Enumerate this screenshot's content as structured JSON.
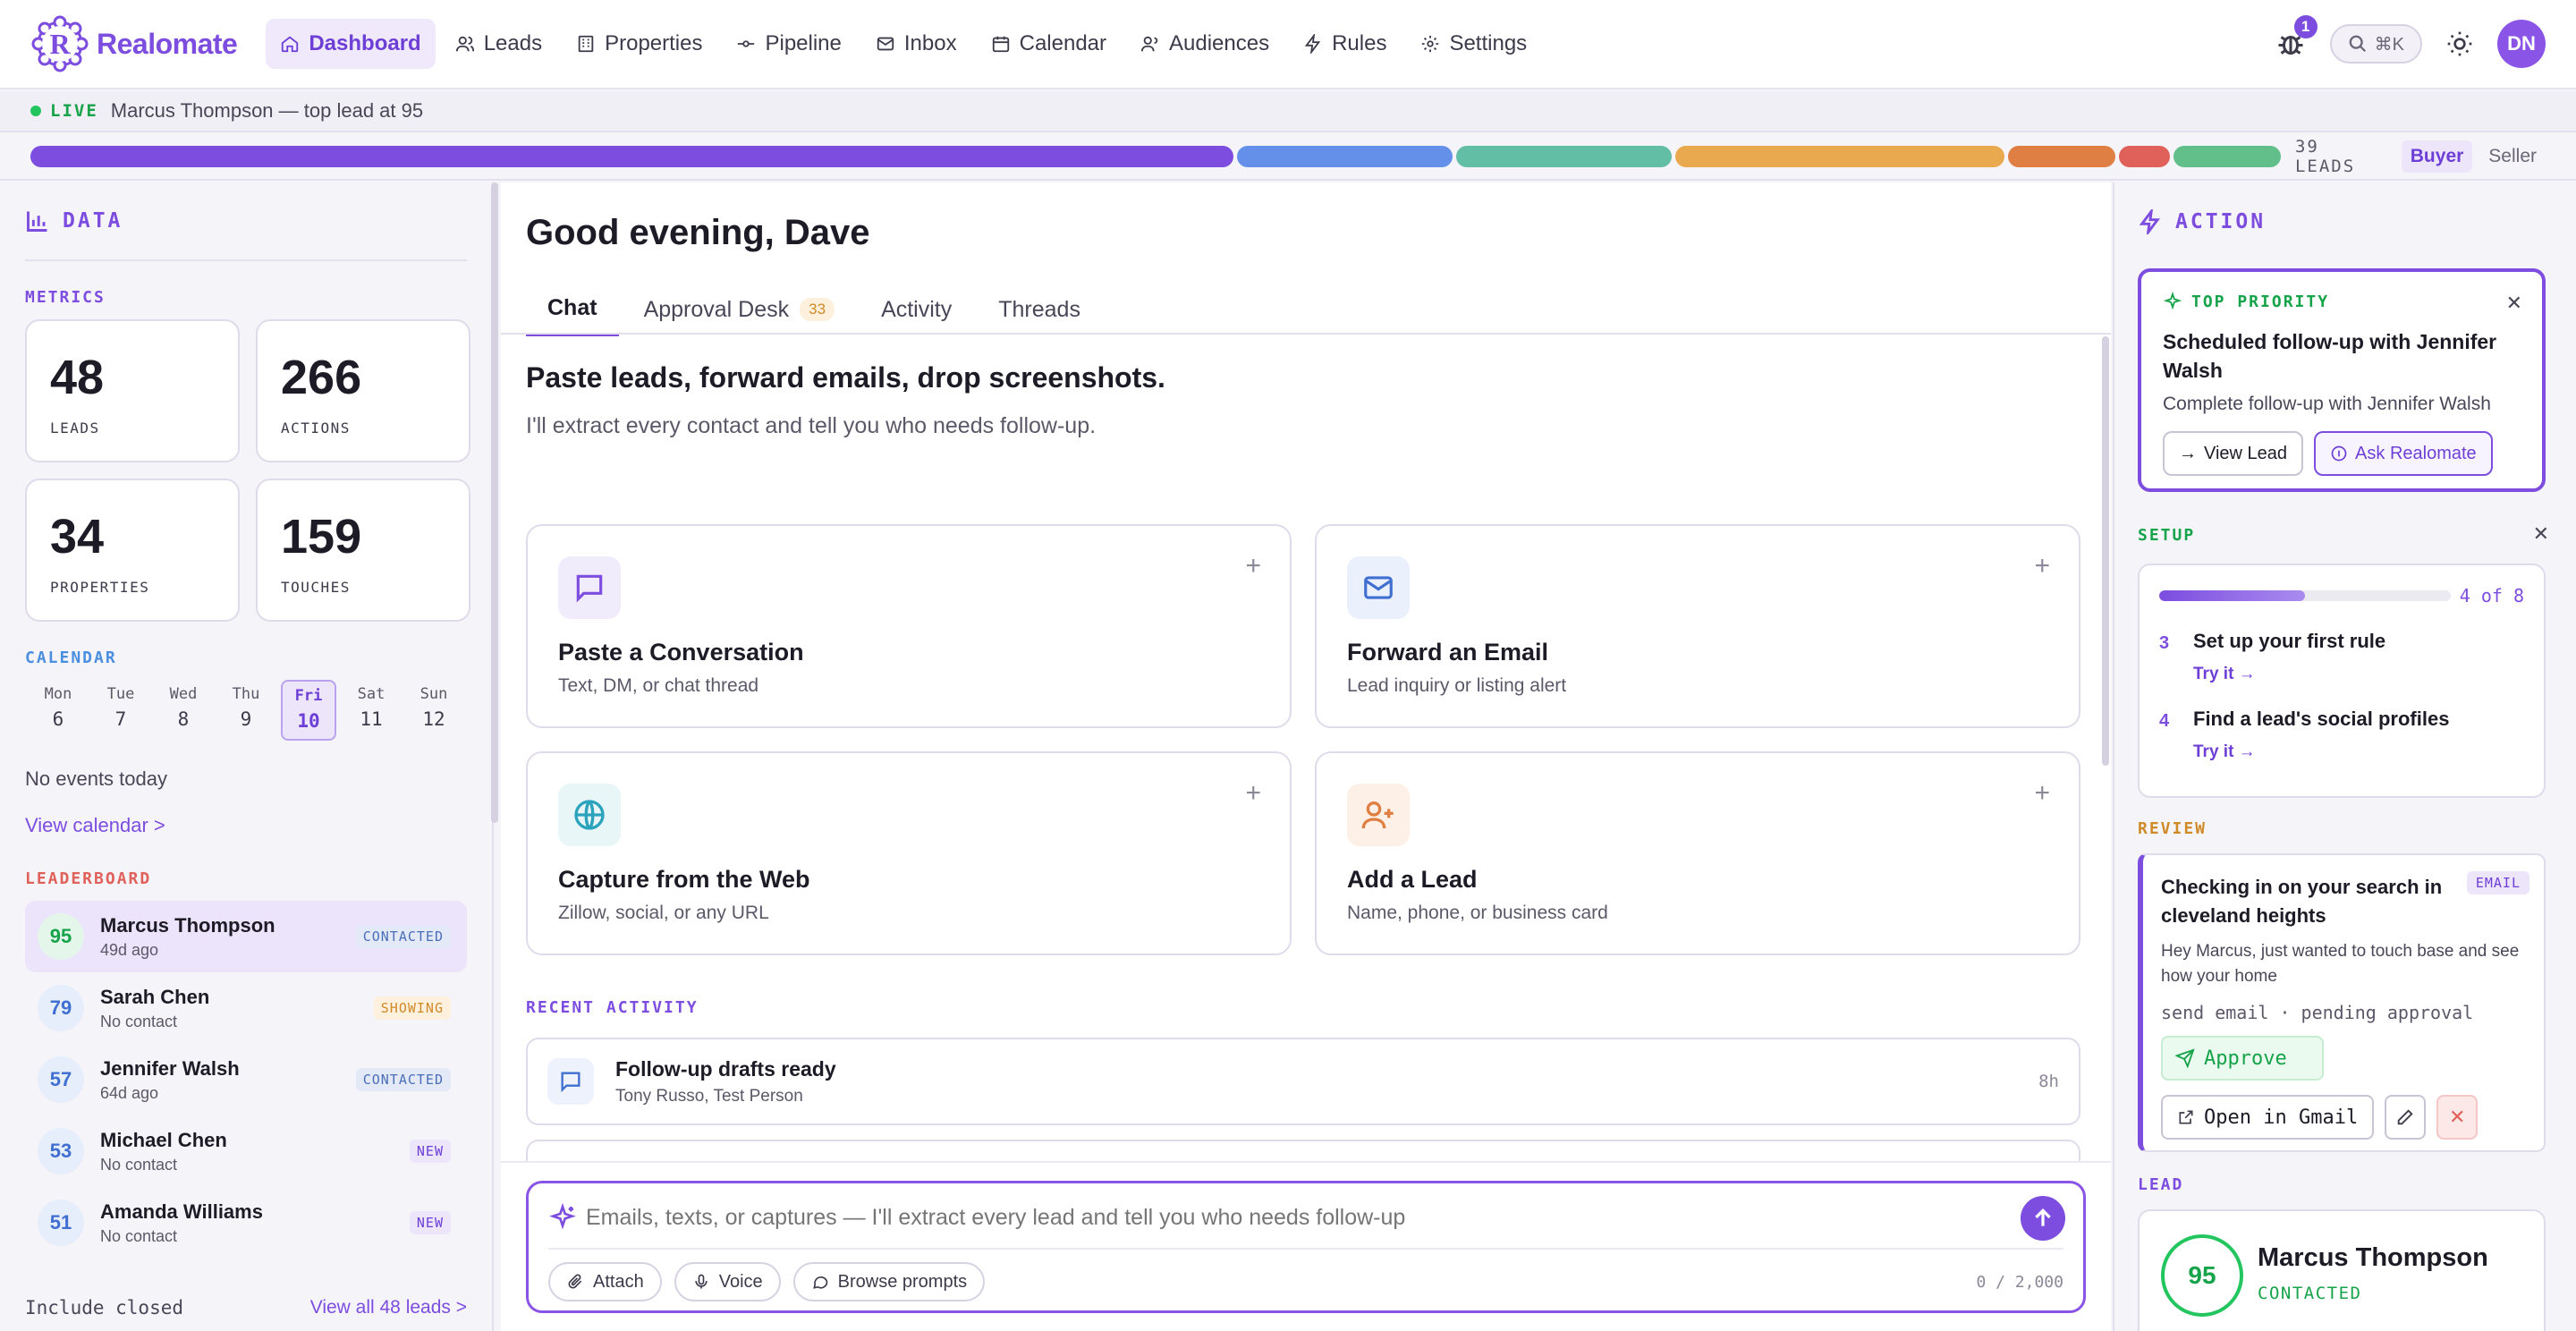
{
  "app": {
    "name": "Realomate",
    "brand_color": "#7c4ddf"
  },
  "nav": [
    {
      "label": "Dashboard",
      "icon": "home-icon",
      "active": true
    },
    {
      "label": "Leads",
      "icon": "users-icon"
    },
    {
      "label": "Properties",
      "icon": "building-icon"
    },
    {
      "label": "Pipeline",
      "icon": "pipeline-icon"
    },
    {
      "label": "Inbox",
      "icon": "mail-icon"
    },
    {
      "label": "Calendar",
      "icon": "calendar-icon"
    },
    {
      "label": "Audiences",
      "icon": "audience-icon"
    },
    {
      "label": "Rules",
      "icon": "bolt-icon"
    },
    {
      "label": "Settings",
      "icon": "gear-icon"
    }
  ],
  "header": {
    "bug_count": "1",
    "search_shortcut": "⌘K",
    "avatar_initials": "DN"
  },
  "ticker": {
    "label": "LIVE",
    "text": "Marcus Thompson — top lead at 95"
  },
  "pipeline": {
    "segments": [
      {
        "value": 19,
        "color": "#7c4ddf"
      },
      {
        "value": 3.4,
        "color": "#6490ea"
      },
      {
        "value": 3.4,
        "color": "#62bfa6"
      },
      {
        "value": 5.2,
        "color": "#e9a94f"
      },
      {
        "value": 1.7,
        "color": "#e07f43"
      },
      {
        "value": 0.8,
        "color": "#e0605a"
      },
      {
        "value": 1.7,
        "color": "#62bf8a"
      }
    ],
    "count_label": "39 LEADS",
    "toggle_on": "Buyer",
    "toggle_off": "Seller"
  },
  "left": {
    "title": "DATA",
    "metrics_label": "METRICS",
    "metrics": [
      {
        "value": "48",
        "label": "LEADS"
      },
      {
        "value": "266",
        "label": "ACTIONS"
      },
      {
        "value": "34",
        "label": "PROPERTIES"
      },
      {
        "value": "159",
        "label": "TOUCHES"
      }
    ],
    "calendar_label": "CALENDAR",
    "days": [
      {
        "name": "Mon",
        "num": "6"
      },
      {
        "name": "Tue",
        "num": "7"
      },
      {
        "name": "Wed",
        "num": "8"
      },
      {
        "name": "Thu",
        "num": "9"
      },
      {
        "name": "Fri",
        "num": "10",
        "today": true
      },
      {
        "name": "Sat",
        "num": "11"
      },
      {
        "name": "Sun",
        "num": "12"
      }
    ],
    "no_events": "No events today",
    "view_calendar": "View calendar >",
    "leaderboard_label": "LEADERBOARD",
    "leaderboard": [
      {
        "score": "95",
        "name": "Marcus Thompson",
        "sub": "49d ago",
        "badge": "CONTACTED",
        "tone": "green",
        "selected": true
      },
      {
        "score": "79",
        "name": "Sarah Chen",
        "sub": "No contact",
        "badge": "SHOWING",
        "tone": "amber"
      },
      {
        "score": "57",
        "name": "Jennifer Walsh",
        "sub": "64d ago",
        "badge": "CONTACTED",
        "tone": "blue"
      },
      {
        "score": "53",
        "name": "Michael Chen",
        "sub": "No contact",
        "badge": "NEW",
        "tone": "blue"
      },
      {
        "score": "51",
        "name": "Amanda Williams",
        "sub": "No contact",
        "badge": "NEW",
        "tone": "blue"
      }
    ],
    "include_closed": "Include closed",
    "view_all": "View all 48 leads >"
  },
  "center": {
    "greeting": "Good evening, Dave",
    "tabs": [
      {
        "label": "Chat",
        "active": true
      },
      {
        "label": "Approval Desk",
        "badge": "33"
      },
      {
        "label": "Activity"
      },
      {
        "label": "Threads"
      }
    ],
    "hero_title": "Paste leads, forward emails, drop screenshots.",
    "hero_sub": "I'll extract every contact and tell you who needs follow-up.",
    "cards": [
      {
        "title": "Paste a Conversation",
        "sub": "Text, DM, or chat thread",
        "icon": "chat-icon",
        "bg": "#f1ecfc"
      },
      {
        "title": "Forward an Email",
        "sub": "Lead inquiry or listing alert",
        "icon": "mail-icon",
        "bg": "#eaf0fc"
      },
      {
        "title": "Capture from the Web",
        "sub": "Zillow, social, or any URL",
        "icon": "globe-icon",
        "bg": "#e8f6f8"
      },
      {
        "title": "Add a Lead",
        "sub": "Name, phone, or business card",
        "icon": "user-plus-icon",
        "bg": "#fdf0e6"
      }
    ],
    "recent_label": "RECENT ACTIVITY",
    "activity": [
      {
        "title": "Follow-up drafts ready",
        "sub": "Tony Russo, Test Person",
        "time": "8h"
      }
    ],
    "composer": {
      "placeholder": "Emails, texts, or captures — I'll extract every lead and tell you who needs follow-up",
      "attach": "Attach",
      "voice": "Voice",
      "browse": "Browse prompts",
      "count": "0 / 2,000"
    }
  },
  "right": {
    "title": "ACTION",
    "priority": {
      "label": "TOP PRIORITY",
      "title": "Scheduled follow-up with Jennifer Walsh",
      "sub": "Complete follow-up with Jennifer Walsh",
      "view_lead": "View Lead",
      "ask": "Ask Realomate"
    },
    "setup": {
      "label": "SETUP",
      "progress": 0.5,
      "progress_text": "4 of 8",
      "steps": [
        {
          "num": "3",
          "title": "Set up your first rule",
          "try": "Try it →"
        },
        {
          "num": "4",
          "title": "Find a lead's social profiles",
          "try": "Try it →"
        }
      ]
    },
    "review": {
      "label": "REVIEW",
      "badge": "EMAIL",
      "title": "Checking in on your search in cleveland heights",
      "body": "Hey Marcus, just wanted to touch base and see how your home",
      "meta": "send email · pending approval",
      "approve": "Approve",
      "open_gmail": "Open in Gmail"
    },
    "lead": {
      "label": "LEAD",
      "score": "95",
      "name": "Marcus Thompson",
      "status": "CONTACTED"
    }
  }
}
